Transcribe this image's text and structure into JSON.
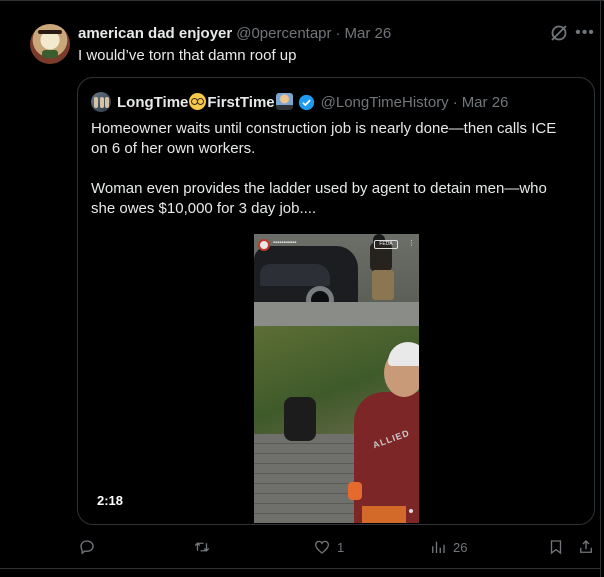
{
  "tweet": {
    "display_name": "american dad enjoyer",
    "handle": "@0percentapr",
    "separator": "·",
    "date": "Mar 26",
    "text": "I would’ve torn that damn roof up"
  },
  "quoted_tweet": {
    "name_part1": "LongTime",
    "name_part2": "FirstTime",
    "emoji_1": "nerd-face-emoji",
    "emoji_2": "technologist-emoji",
    "verified": true,
    "handle": "@LongTimeHistory",
    "separator": "·",
    "date": "Mar 26",
    "paragraph_1": "Homeowner waits until construction job is nearly done—then calls ICE\non 6 of her own workers.",
    "paragraph_2": "Woman even provides the ladder used by agent to detain men—who\nshe owes $10,000 for 3 day job....",
    "video": {
      "duration": "2:18",
      "overlay_button": "FEDA",
      "shirt_text": "ALLIED"
    }
  },
  "actions": {
    "reply": {
      "icon": "reply-icon",
      "count": ""
    },
    "repost": {
      "icon": "repost-icon",
      "count": ""
    },
    "like": {
      "icon": "heart-icon",
      "count": "1"
    },
    "views": {
      "icon": "views-icon",
      "count": "26"
    },
    "bookmark": {
      "icon": "bookmark-icon",
      "count": ""
    },
    "share": {
      "icon": "share-icon",
      "count": ""
    }
  },
  "colors": {
    "background": "#000000",
    "text_primary": "#e7e9ea",
    "text_secondary": "#71767b",
    "border": "#2f3336",
    "verified": "#1d9bf0"
  }
}
